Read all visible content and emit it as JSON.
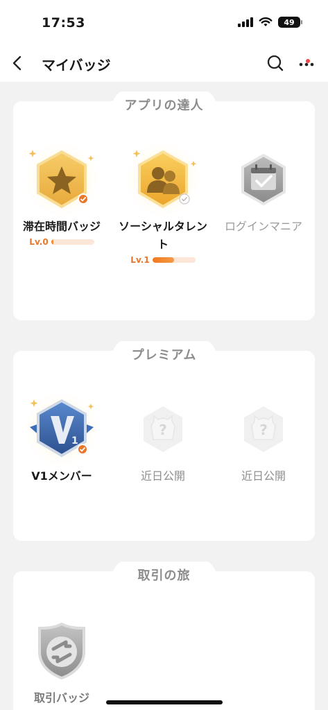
{
  "status_bar": {
    "time": "17:53",
    "battery": "49"
  },
  "nav": {
    "title": "マイバッジ"
  },
  "sections": [
    {
      "title": "アプリの達人",
      "badges": [
        {
          "name": "滞在時間バッジ",
          "level": "Lv.0",
          "progress": 0.05
        },
        {
          "name_line1": "ソーシャルタレン",
          "name_line2": "ト",
          "level": "Lv.1",
          "progress": 0.5
        },
        {
          "name": "ログインマニア"
        }
      ]
    },
    {
      "title": "プレミアム",
      "badges": [
        {
          "name": "V1メンバー"
        },
        {
          "name": "近日公開"
        },
        {
          "name": "近日公開"
        }
      ]
    },
    {
      "title": "取引の旅",
      "badges": [
        {
          "name": "取引バッジ"
        }
      ]
    }
  ],
  "colors": {
    "accent": "#e8772a",
    "gold": "#f2b33a",
    "blue": "#3d6fb8",
    "grey": "#9a9a9a"
  },
  "icons": [
    "back-icon",
    "search-icon",
    "more-icon",
    "star-icon",
    "people-icon",
    "calendar-check-icon",
    "v1-icon",
    "question-icon",
    "exchange-icon",
    "check-mark-icon"
  ]
}
